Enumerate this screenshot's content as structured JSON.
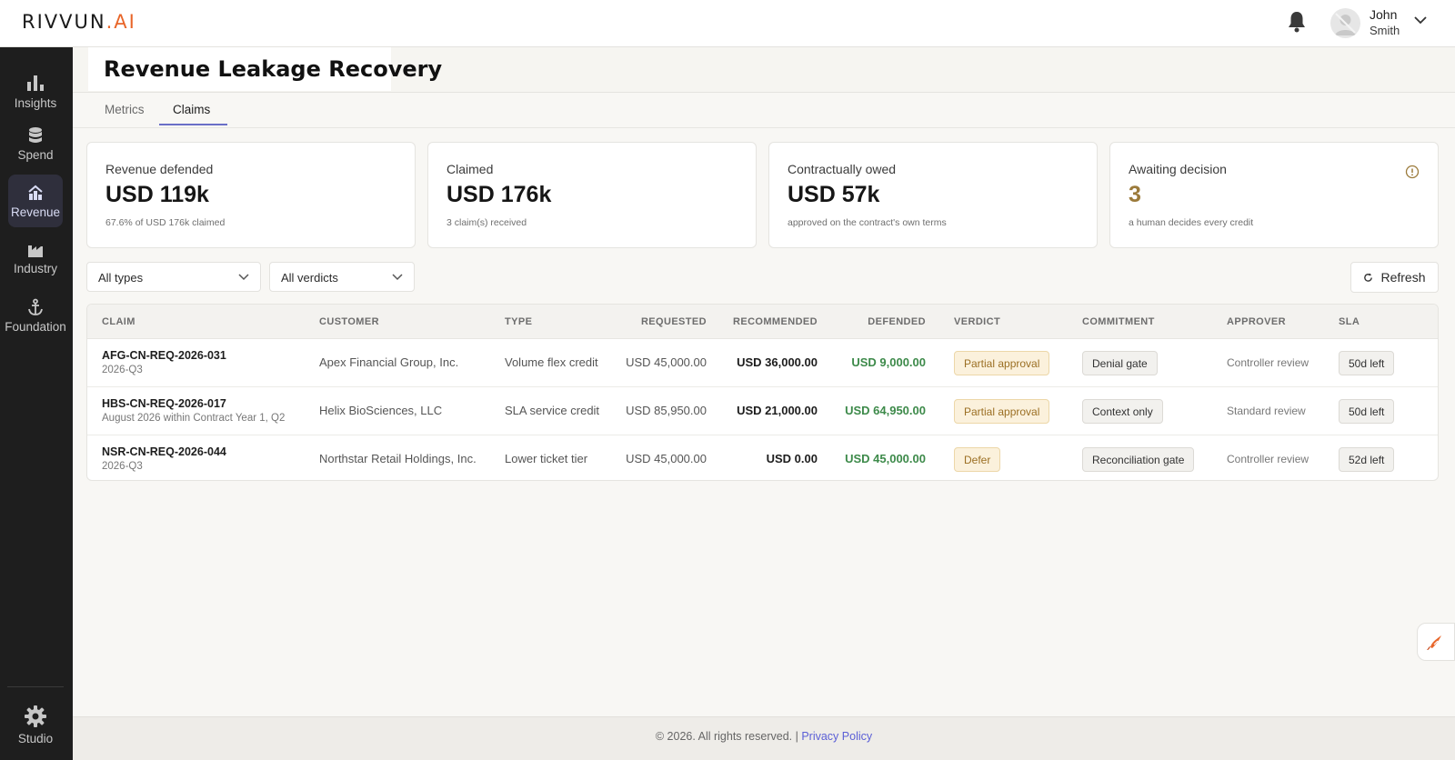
{
  "brand": {
    "name_main": "RIVVUN",
    "name_suffix": ".AI",
    "accent": "#e8662a"
  },
  "header": {
    "user_first": "John",
    "user_last": "Smith"
  },
  "sidebar": {
    "items": [
      {
        "label": "Insights",
        "icon": "bar-chart-icon",
        "active": false
      },
      {
        "label": "Spend",
        "icon": "database-icon",
        "active": false
      },
      {
        "label": "Revenue",
        "icon": "revenue-icon",
        "active": true
      },
      {
        "label": "Industry",
        "icon": "factory-icon",
        "active": false
      },
      {
        "label": "Foundation",
        "icon": "anchor-icon",
        "active": false
      }
    ],
    "studio": {
      "label": "Studio",
      "icon": "gear-icon"
    }
  },
  "page": {
    "title": "Revenue Leakage Recovery",
    "tabs": [
      {
        "label": "Metrics",
        "active": false
      },
      {
        "label": "Claims",
        "active": true
      }
    ]
  },
  "cards": [
    {
      "label": "Revenue defended",
      "value": "USD 119k",
      "sub": "67.6% of USD 176k claimed"
    },
    {
      "label": "Claimed",
      "value": "USD 176k",
      "sub": "3 claim(s) received"
    },
    {
      "label": "Contractually owed",
      "value": "USD 57k",
      "sub": "approved on the contract's own terms"
    },
    {
      "label": "Awaiting decision",
      "value": "3",
      "sub": "a human decides every credit",
      "value_color": "#9b7a3a"
    }
  ],
  "filters": {
    "type_selected": "All types",
    "verdict_selected": "All verdicts",
    "refresh_label": "Refresh"
  },
  "table": {
    "columns": [
      "CLAIM",
      "CUSTOMER",
      "TYPE",
      "REQUESTED",
      "RECOMMENDED",
      "DEFENDED",
      "VERDICT",
      "COMMITMENT",
      "APPROVER",
      "SLA"
    ],
    "rows": [
      {
        "claim_id": "AFG-CN-REQ-2026-031",
        "period": "2026-Q3",
        "customer": "Apex Financial Group, Inc.",
        "type": "Volume flex credit",
        "requested": "USD 45,000.00",
        "recommended": "USD 36,000.00",
        "defended": "USD 9,000.00",
        "verdict": "Partial approval",
        "commitment": "Denial gate",
        "approver": "Controller review",
        "sla": "50d left"
      },
      {
        "claim_id": "HBS-CN-REQ-2026-017",
        "period": "August 2026 within Contract Year 1, Q2",
        "customer": "Helix BioSciences, LLC",
        "type": "SLA service credit",
        "requested": "USD 85,950.00",
        "recommended": "USD 21,000.00",
        "defended": "USD 64,950.00",
        "verdict": "Partial approval",
        "commitment": "Context only",
        "approver": "Standard review",
        "sla": "50d left"
      },
      {
        "claim_id": "NSR-CN-REQ-2026-044",
        "period": "2026-Q3",
        "customer": "Northstar Retail Holdings, Inc.",
        "type": "Lower ticket tier",
        "requested": "USD 45,000.00",
        "recommended": "USD 0.00",
        "defended": "USD 45,000.00",
        "verdict": "Defer",
        "commitment": "Reconciliation gate",
        "approver": "Controller review",
        "sla": "52d left"
      }
    ]
  },
  "footer": {
    "copyright": "© 2026. All rights reserved. |",
    "privacy_label": "Privacy Policy"
  },
  "colors": {
    "defended_green": "#3d8a4a",
    "tab_accent": "#6a6fc7",
    "sidebar_bg": "#1e1e1e"
  }
}
